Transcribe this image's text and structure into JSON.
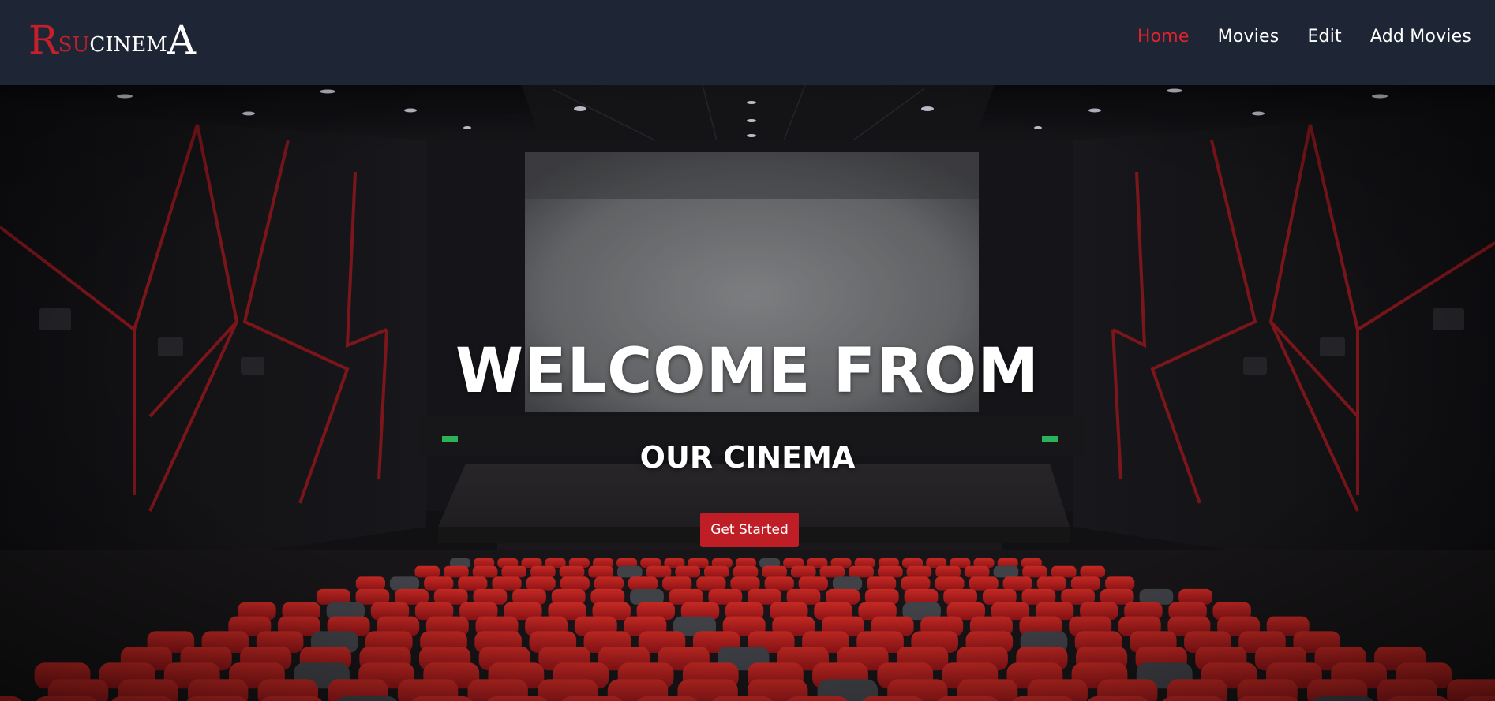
{
  "brand": {
    "logo_r": "R",
    "logo_su": "SU",
    "logo_cinem": "CINEM",
    "logo_a": "A"
  },
  "nav": {
    "items": [
      {
        "label": "Home",
        "active": true
      },
      {
        "label": "Movies",
        "active": false
      },
      {
        "label": "Edit",
        "active": false
      },
      {
        "label": "Add Movies",
        "active": false
      }
    ]
  },
  "hero": {
    "title": "WELCOME FROM",
    "subtitle": "OUR CINEMA",
    "cta_label": "Get Started"
  },
  "colors": {
    "navbar_bg": "#1e2636",
    "accent_red": "#c01e26",
    "active_link": "#e0222b",
    "text": "#ffffff"
  }
}
